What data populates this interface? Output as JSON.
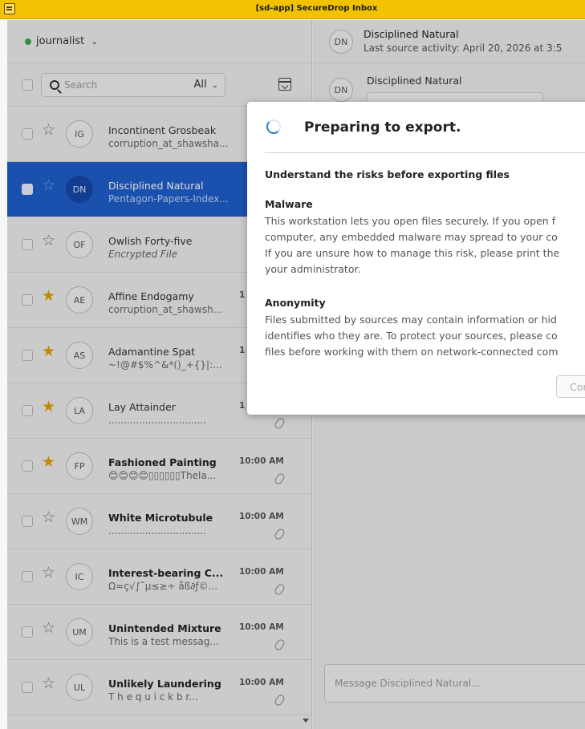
{
  "window": {
    "title": "[sd-app] SecureDrop Inbox"
  },
  "user": {
    "name": "journalist",
    "caret": "⌄"
  },
  "search": {
    "placeholder": "Search",
    "filter": "All",
    "filter_caret": "⌄"
  },
  "sources": [
    {
      "initials": "IG",
      "name": "Incontinent Grosbeak",
      "preview": "corruption_at_shawsha...",
      "time": "",
      "starred": false,
      "bold": false,
      "italic": false,
      "attachment": false,
      "selected": false
    },
    {
      "initials": "DN",
      "name": "Disciplined Natural",
      "preview": "Pentagon-Papers-Index...",
      "time": "",
      "starred": false,
      "bold": false,
      "italic": false,
      "attachment": false,
      "selected": true
    },
    {
      "initials": "OF",
      "name": "Owlish Forty-five",
      "preview": "Encrypted File",
      "time": "",
      "starred": false,
      "bold": false,
      "italic": true,
      "attachment": false,
      "selected": false
    },
    {
      "initials": "AE",
      "name": "Affine Endogamy",
      "preview": "corruption_at_shawsh...",
      "time": "1",
      "starred": true,
      "bold": false,
      "italic": false,
      "attachment": false,
      "selected": false
    },
    {
      "initials": "AS",
      "name": "Adamantine Spat",
      "preview": "~!@#$%^&*()_+{}|:...",
      "time": "1",
      "starred": true,
      "bold": false,
      "italic": false,
      "attachment": false,
      "selected": false
    },
    {
      "initials": "LA",
      "name": "Lay Attainder",
      "preview": "................................",
      "time": "1",
      "starred": true,
      "bold": false,
      "italic": false,
      "attachment": true,
      "selected": false
    },
    {
      "initials": "FP",
      "name": "Fashioned Painting",
      "preview": "😊😊😊😊▯▯▯▯▯▯Thela...",
      "time": "10:00 AM",
      "starred": true,
      "bold": true,
      "italic": false,
      "attachment": true,
      "selected": false
    },
    {
      "initials": "WM",
      "name": "White Microtubule",
      "preview": "................................",
      "time": "10:00 AM",
      "starred": false,
      "bold": true,
      "italic": false,
      "attachment": true,
      "selected": false
    },
    {
      "initials": "IC",
      "name": "Interest-bearing C...",
      "preview": "Ω≈ç√∫˜µ≤≥÷ åß∂ƒ©...",
      "time": "10:00 AM",
      "starred": false,
      "bold": true,
      "italic": false,
      "attachment": true,
      "selected": false
    },
    {
      "initials": "UM",
      "name": "Unintended Mixture",
      "preview": "This is a test messag...",
      "time": "10:00 AM",
      "starred": false,
      "bold": true,
      "italic": false,
      "attachment": true,
      "selected": false
    },
    {
      "initials": "UL",
      "name": "Unlikely Laundering",
      "preview": "T h e  q u i c k  b r...",
      "time": "10:00 AM",
      "starred": false,
      "bold": true,
      "italic": false,
      "attachment": true,
      "selected": false
    }
  ],
  "conversation": {
    "initials": "DN",
    "name": "Disciplined Natural",
    "last_activity": "Last source activity: April 20, 2026 at 3:5",
    "message_author": "Disciplined Natural",
    "composer_placeholder": "Message Disciplined Natural..."
  },
  "dialog": {
    "title": "Preparing to export.",
    "heading": "Understand the risks before exporting files",
    "malware_title": "Malware",
    "malware_lines": [
      "This workstation lets you open files securely. If you open f",
      "computer, any embedded malware may spread to your co",
      "If you are unsure how to manage this risk, please print the",
      "your administrator."
    ],
    "anonymity_title": "Anonymity",
    "anonymity_lines": [
      "Files submitted by sources may contain information or hid",
      "identifies who they are. To protect your sources, please co",
      "files before working with them on network-connected com"
    ],
    "continue_label": "Cor"
  },
  "icons": {
    "menu": "menu-icon",
    "status": "online-dot-icon",
    "search": "search-icon",
    "date_filter": "calendar-icon",
    "star": "star-icon",
    "attachment": "paperclip-icon",
    "spinner": "spinner-icon",
    "scroll": "scroll-down-arrow-icon"
  },
  "colors": {
    "titlebar": "#f2c200",
    "selected": "#1f5fcc",
    "star": "#e0a000",
    "online": "#3aa64a"
  }
}
